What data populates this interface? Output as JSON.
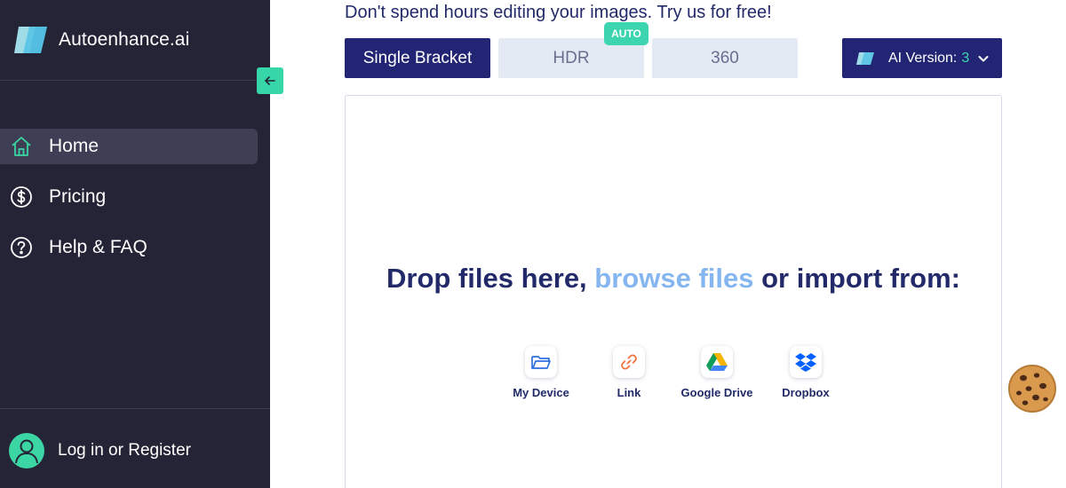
{
  "app": {
    "name": "Autoenhance.ai"
  },
  "sidebar": {
    "items": [
      {
        "label": "Home",
        "icon": "home-icon",
        "active": true
      },
      {
        "label": "Pricing",
        "icon": "dollar-icon",
        "active": false
      },
      {
        "label": "Help & FAQ",
        "icon": "question-icon",
        "active": false
      }
    ],
    "login_label": "Log in or Register"
  },
  "main": {
    "headline": "Don't spend hours editing your images. Try us for free!",
    "modes": [
      {
        "label": "Single Bracket",
        "active": true
      },
      {
        "label": "HDR",
        "active": false
      },
      {
        "label": "360",
        "active": false
      }
    ],
    "auto_badge": "AUTO",
    "ai_version": {
      "label": "AI Version:",
      "value": "3"
    },
    "dropzone": {
      "text_before": "Drop files here, ",
      "link_text": "browse files",
      "text_after": " or import from:",
      "sources": [
        {
          "label": "My Device",
          "icon": "folder-icon"
        },
        {
          "label": "Link",
          "icon": "link-icon"
        },
        {
          "label": "Google Drive",
          "icon": "google-drive-icon"
        },
        {
          "label": "Dropbox",
          "icon": "dropbox-icon"
        }
      ]
    }
  },
  "colors": {
    "sidebar_bg": "#252436",
    "accent_green": "#3cd5a4",
    "navy": "#222573",
    "link_blue": "#86b6f0"
  }
}
